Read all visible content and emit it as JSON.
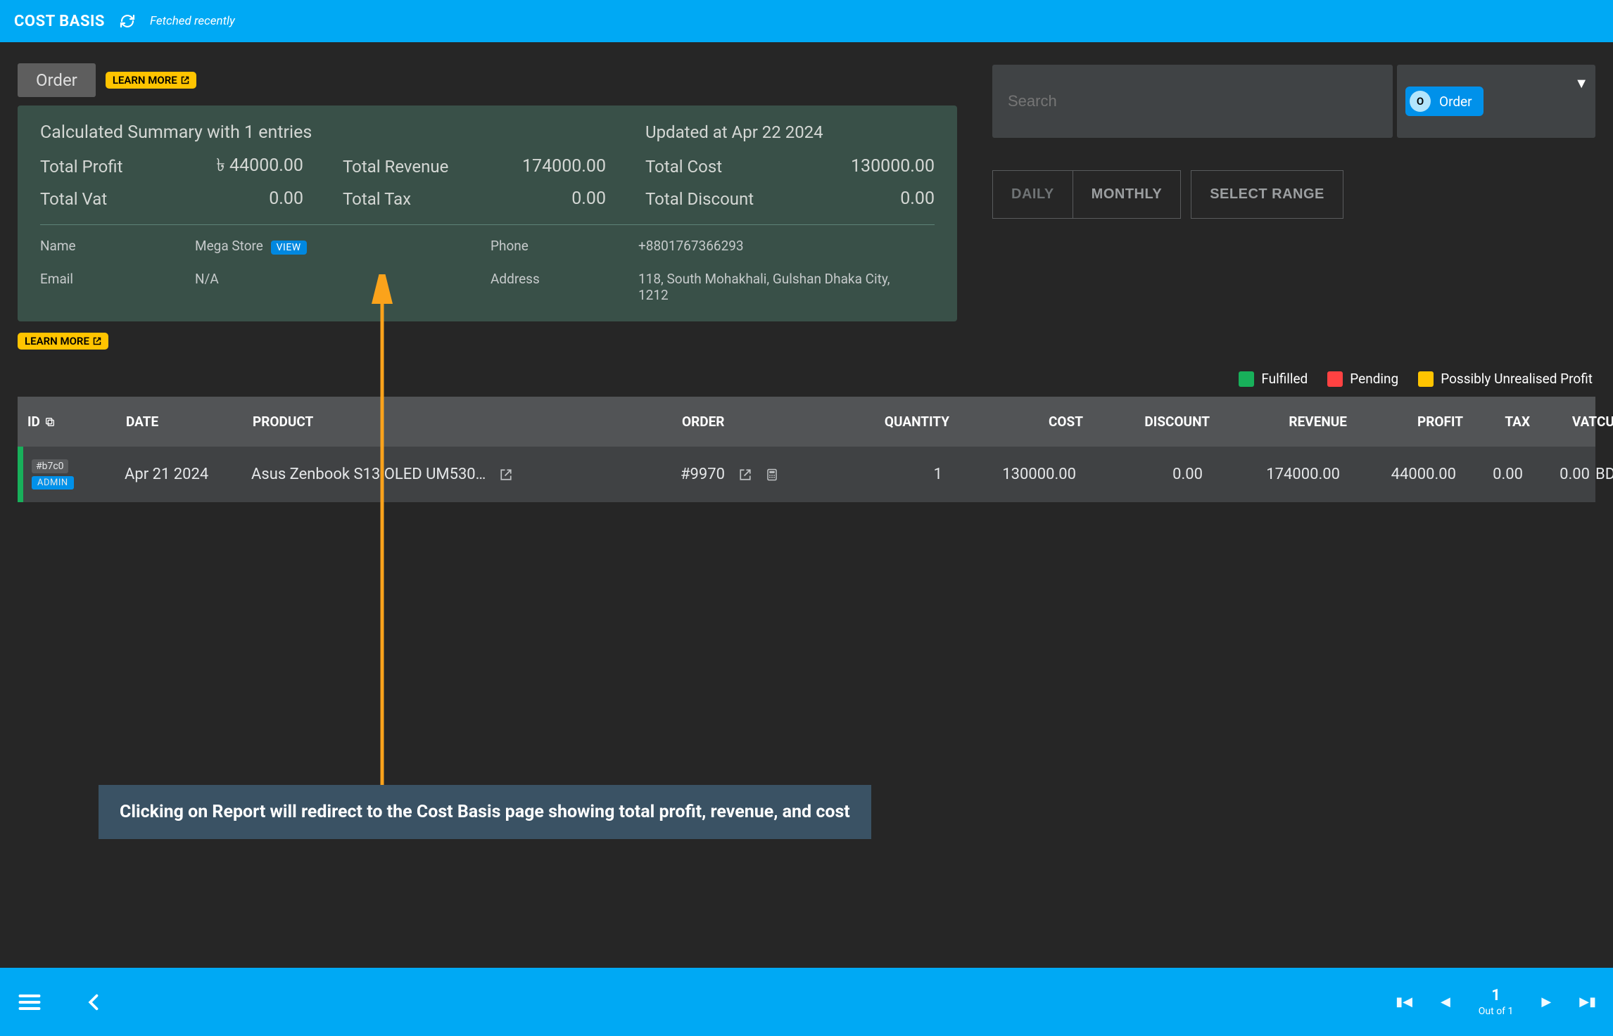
{
  "header": {
    "title": "COST BASIS",
    "fetched_text": "Fetched recently"
  },
  "colors": {
    "accent": "#00A9F4",
    "yellow": "#FFC400",
    "green": "#18B05A",
    "red": "#FF4242"
  },
  "card": {
    "tab_label": "Order",
    "learn_more": "LEARN MORE",
    "summary_title": "Calculated Summary with 1 entries",
    "updated_text": "Updated at Apr 22 2024",
    "stats": {
      "total_profit_label": "Total Profit",
      "total_profit": "৳ 44000.00",
      "total_revenue_label": "Total Revenue",
      "total_revenue": "174000.00",
      "total_cost_label": "Total Cost",
      "total_cost": "130000.00",
      "total_vat_label": "Total Vat",
      "total_vat": "0.00",
      "total_tax_label": "Total Tax",
      "total_tax": "0.00",
      "total_discount_label": "Total Discount",
      "total_discount": "0.00"
    },
    "details": {
      "name_label": "Name",
      "name_value": "Mega Store",
      "view_button": "VIEW",
      "phone_label": "Phone",
      "phone_value": "+8801767366293",
      "email_label": "Email",
      "email_value": "N/A",
      "address_label": "Address",
      "address_value": "118, South Mohakhali, Gulshan Dhaka City, 1212"
    }
  },
  "learn_more_2": "LEARN MORE",
  "search": {
    "placeholder": "Search",
    "chip_letter": "O",
    "chip_text": "Order"
  },
  "range": {
    "daily": "DAILY",
    "monthly": "MONTHLY",
    "select_range": "SELECT RANGE"
  },
  "legend": {
    "fulfilled": "Fulfilled",
    "pending": "Pending",
    "possibly": "Possibly Unrealised Profit"
  },
  "table": {
    "headers": {
      "id": "ID",
      "date": "DATE",
      "product": "PRODUCT",
      "order": "ORDER",
      "quantity": "QUANTITY",
      "cost": "COST",
      "discount": "DISCOUNT",
      "revenue": "REVENUE",
      "profit": "PROFIT",
      "tax": "TAX",
      "vat": "VAT",
      "currency": "CURRENCY"
    },
    "rows": [
      {
        "id": "#b7c0",
        "badge": "ADMIN",
        "date": "Apr 21 2024",
        "product": "Asus Zenbook S13 OLED UM530…",
        "order": "#9970",
        "quantity": "1",
        "cost": "130000.00",
        "discount": "0.00",
        "revenue": "174000.00",
        "profit": "44000.00",
        "tax": "0.00",
        "vat": "0.00",
        "currency": "BDT"
      }
    ]
  },
  "footer": {
    "page_number": "1",
    "out_of": "Out of 1"
  },
  "annotation": {
    "text": "Clicking on Report will redirect to the Cost Basis page showing total profit, revenue, and cost"
  }
}
